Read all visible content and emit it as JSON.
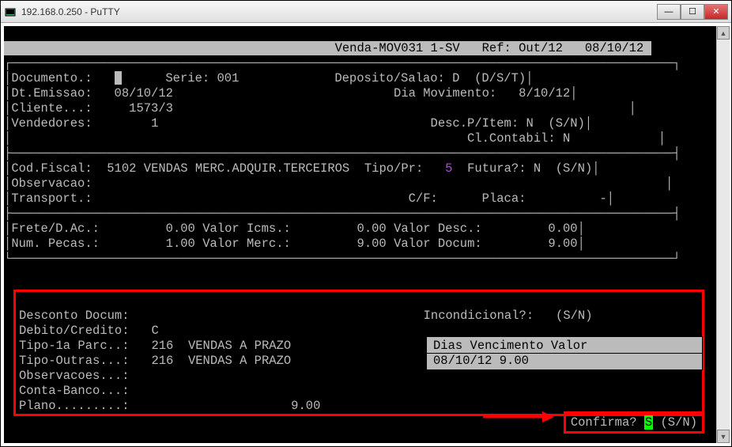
{
  "window": {
    "title": "192.168.0.250 - PuTTY"
  },
  "header": {
    "program": "Venda-MOV031 1-SV",
    "ref": "Ref: Out/12",
    "date": "08/10/12"
  },
  "section1": {
    "documento_label": "Documento.:",
    "documento_value": "",
    "serie_label": "Serie:",
    "serie_value": "001",
    "deposito_label": "Deposito/Salao:",
    "deposito_value": "D",
    "deposito_options": "(D/S/T)",
    "dtemissao_label": "Dt.Emissao:",
    "dtemissao_value": "08/10/12",
    "diamov_label": "Dia Movimento:",
    "diamov_value": "8/10/12",
    "cliente_label": "Cliente...:",
    "cliente_value": "1573/3",
    "vendedores_label": "Vendedores:",
    "vendedores_value": "1",
    "descp_label": "Desc.P/Item:",
    "descp_value": "N",
    "descp_options": "(S/N)",
    "clcontabil_label": "Cl.Contabil:",
    "clcontabil_value": "N"
  },
  "section2": {
    "codfiscal_label": "Cod.Fiscal:",
    "codfiscal_value": "5102",
    "codfiscal_desc": "VENDAS MERC.ADQUIR.TERCEIROS",
    "tipopr_label": "Tipo/Pr:",
    "tipopr_value": "5",
    "futura_label": "Futura?:",
    "futura_value": "N",
    "futura_options": "(S/N)",
    "observacao_label": "Observacao:",
    "transport_label": "Transport.:",
    "cf_label": "C/F:",
    "placa_label": "Placa:",
    "placa_value": "-"
  },
  "section3": {
    "frete_label": "Frete/D.Ac.:",
    "frete_value": "0.00",
    "vicms_label": "Valor Icms.:",
    "vicms_value": "0.00",
    "vdesc_label": "Valor Desc.:",
    "vdesc_value": "0.00",
    "numpecas_label": "Num. Pecas.:",
    "numpecas_value": "1.00",
    "vmerc_label": "Valor Merc.:",
    "vmerc_value": "9.00",
    "vdocum_label": "Valor Docum:",
    "vdocum_value": "9.00"
  },
  "section4": {
    "descdocum_label": "Desconto Docum:",
    "incond_label": "Incondicional?:",
    "incond_options": "(S/N)",
    "debcred_label": "Debito/Credito:",
    "debcred_value": "C",
    "tipo1a_label": "Tipo-1a Parc..:",
    "tipo1a_value": "216",
    "tipo1a_desc": "VENDAS A PRAZO",
    "tipooutras_label": "Tipo-Outras...:",
    "tipooutras_value": "216",
    "tipooutras_desc": "VENDAS A PRAZO",
    "observacoes_label": "Observacoes...:",
    "contabanco_label": "Conta-Banco...:",
    "plano_label": "Plano.........:",
    "plano_value": "9.00"
  },
  "table": {
    "h1": "Dias",
    "h2": "Vencimento",
    "h3": "Valor",
    "r1c1": "",
    "r1c2": "08/10/12",
    "r1c3": "9.00"
  },
  "confirm": {
    "label": "Confirma?",
    "value": "S",
    "options": "(S/N)"
  }
}
